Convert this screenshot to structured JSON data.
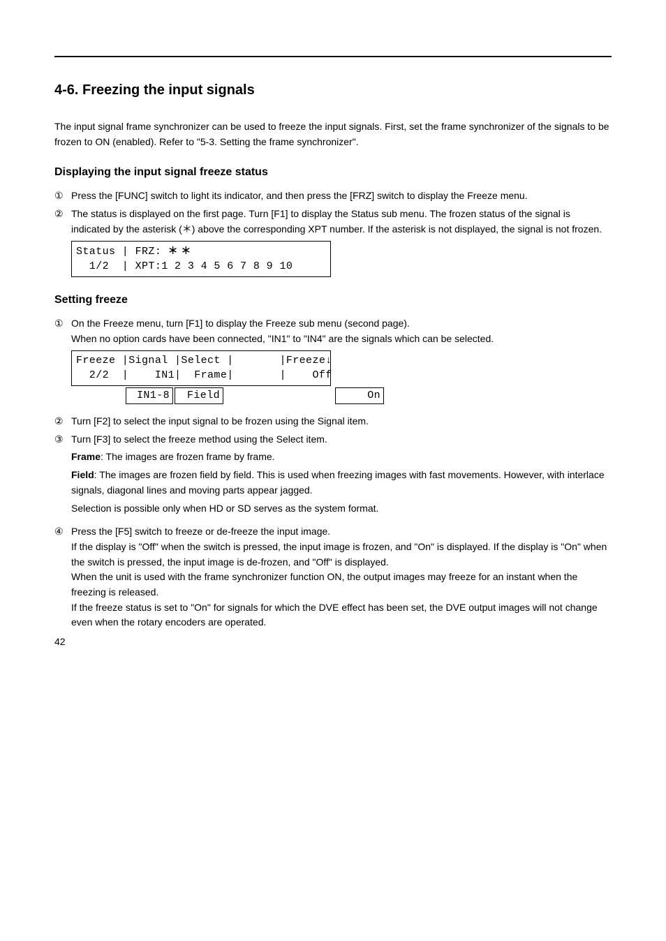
{
  "section": {
    "title": "4-6. Freezing the input signals",
    "intro": "The input signal frame synchronizer can be used to freeze the input signals. First, set the frame synchronizer of the signals to be frozen to ON (enabled). Refer to \"5-3. Setting the frame synchronizer\"."
  },
  "status": {
    "heading": "Displaying the input signal freeze status",
    "step1": "Press the [FUNC] switch to light its indicator, and then press the [FRZ] switch to display the Freeze menu.",
    "step2": "The status is displayed on the first page. Turn [F1] to display the Status sub menu. The frozen status of the signal is indicated by the asterisk (",
    "step2_asterisk_suffix": ") above the corresponding XPT number. If the asterisk is not displayed, the signal is not frozen.",
    "lcd_line1_prefix": "Status | FRZ: ",
    "lcd_line1_ast": "＊ ＊",
    "lcd_line2": "  1/2  | XPT:1 2 3 4 5 6 7 8 9 10"
  },
  "freeze": {
    "heading": "Setting freeze",
    "step1_a": "On the Freeze menu, turn [F1] to display the Freeze sub menu (second page).",
    "step1_b": "When no option cards have been connected, \"IN1\" to \"IN4\" are the signals which can be selected.",
    "lcd_line1": "Freeze |Signal |Select |       |Freeze↓",
    "lcd_line2": "  2/2  |    IN1|  Frame|       |    Off",
    "opt_col1": "IN1-8",
    "opt_col2": "Field",
    "opt_col3": "On",
    "step2": "Turn [F2] to select the input signal to be frozen using the Signal item.",
    "step3_intro": "Turn [F3] to select the freeze method using the Select item.",
    "step3_frame_label": "Frame",
    "step3_frame_text": ": The images are frozen frame by frame.",
    "step3_field_label": "Field",
    "step3_field_text": ": The images are frozen field by field. This is used when freezing images with fast movements. However, with interlace signals, diagonal lines and moving parts appear jagged.",
    "step3_note": "Selection is possible only when HD or SD serves as the system format.",
    "step4_a": "Press the [F5] switch to freeze or de-freeze the input image.",
    "step4_b": "If the display is \"Off\" when the switch is pressed, the input image is frozen, and \"On\" is displayed. If the display is \"On\" when the switch is pressed, the input image is de-frozen, and \"Off\" is displayed.",
    "step4_c": "When the unit is used with the frame synchronizer function ON, the output images may freeze for an instant when the freezing is released.",
    "step4_d": "If the freeze status is set to \"On\" for signals for which the DVE effect has been set, the DVE output images will not change even when the rotary encoders are operated."
  },
  "page_num": "42"
}
